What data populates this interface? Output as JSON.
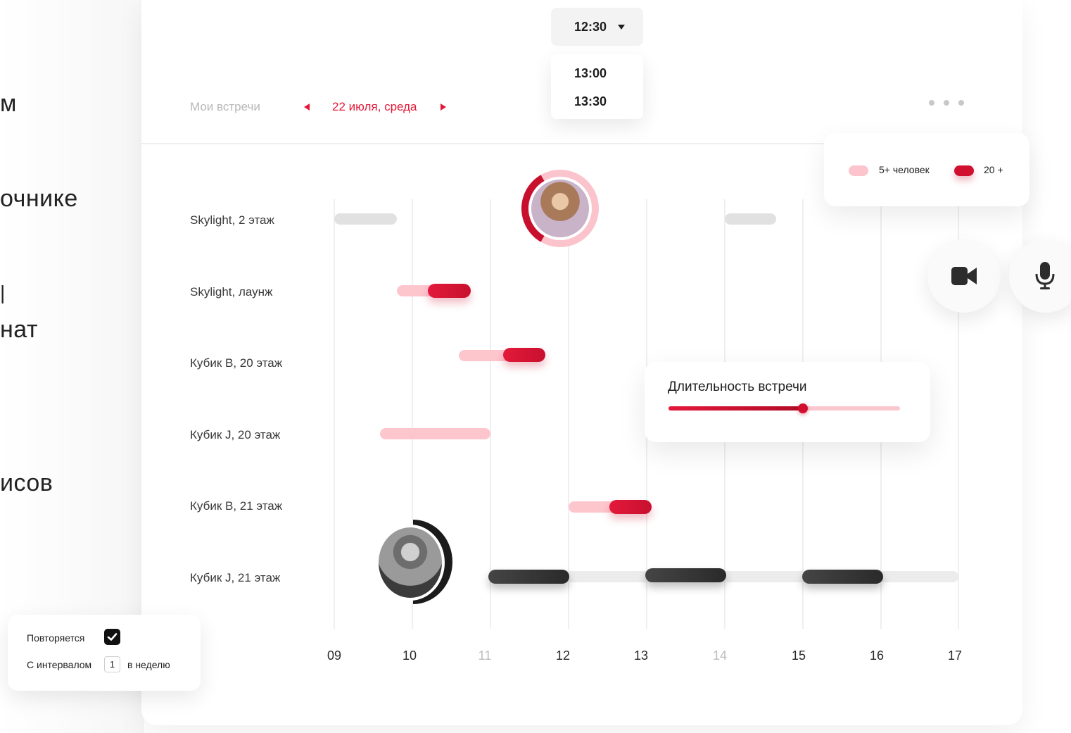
{
  "left_column_text": [
    "м",
    "очнике",
    "|",
    "нат",
    "исов"
  ],
  "header": {
    "my_meetings_label": "Мои встречи",
    "date_label": "22 июля, среда"
  },
  "time_select": {
    "value": "12:30",
    "options": [
      "13:00",
      "13:30"
    ]
  },
  "legend": {
    "items": [
      {
        "label": "5+ человек",
        "color": "#fcc4cc"
      },
      {
        "label": "20 +",
        "color": "#d0102e"
      }
    ]
  },
  "rooms": [
    "Skylight, 2 этаж",
    "Skylight, лаунж",
    "Кубик  B, 20 этаж",
    "Кубик  J, 20 этаж",
    "Кубик  B, 21 этаж",
    "Кубик  J, 21 этаж"
  ],
  "hours": [
    "09",
    "10",
    "11",
    "12",
    "13",
    "14",
    "15",
    "16",
    "17"
  ],
  "duration_card": {
    "title": "Длительность встречи",
    "level": 0.58
  },
  "repeat_card": {
    "repeat_label": "Повторяется",
    "repeat_checked": true,
    "interval_label": "С интервалом",
    "interval_value": "1",
    "interval_unit": "в неделю"
  },
  "icons": [
    "video-camera-icon",
    "microphone-icon",
    "checkmark-icon",
    "arrow-left-icon",
    "arrow-right-icon",
    "caret-down-icon",
    "more-dots-icon"
  ],
  "colors": {
    "accent": "#e31837",
    "pink": "#fdc6cd",
    "dark": "#2a2a2a"
  }
}
